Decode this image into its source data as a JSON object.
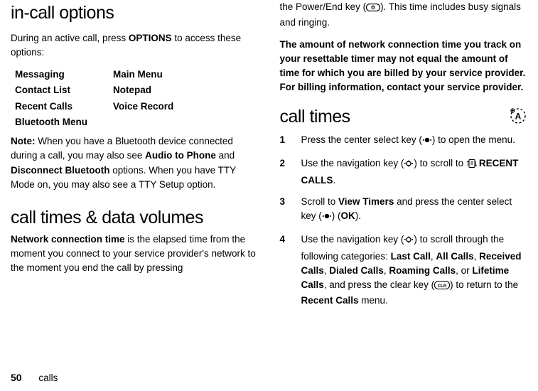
{
  "section1": {
    "title": "in-call options",
    "intro_pre": "During an active call, press ",
    "intro_key": "OPTIONS",
    "intro_post": " to access these options:",
    "table": [
      [
        "Messaging",
        "Main Menu"
      ],
      [
        "Contact List",
        "Notepad"
      ],
      [
        "Recent Calls",
        "Voice Record"
      ],
      [
        "Bluetooth Menu",
        ""
      ]
    ],
    "note_label": "Note:",
    "note_p1a": " When you have a Bluetooth device connected during a call, you may also see ",
    "note_audio": "Audio to Phone",
    "note_and": " and ",
    "note_disc": "Disconnect Bluetooth",
    "note_p1b": " options. When you have TTY Mode on, you may also see a TTY Setup option."
  },
  "section2": {
    "title": "call times & data volumes",
    "p1a": "Network connection time",
    "p1b": " is the elapsed time from the moment you connect to your service provider's network to the moment you end the call by pressing"
  },
  "col2": {
    "p1a": "the Power/End key (",
    "p1b": "). This time includes busy signals and ringing.",
    "p2": "The amount of network connection time you track on your resettable timer may not equal the amount of time for which you are billed by your service provider. For billing information, contact your service provider.",
    "calltimes_title": "call times",
    "steps": {
      "s1a": "Press the center select key (",
      "s1b": ") to open the menu.",
      "s2a": "Use the navigation key (",
      "s2b": ") to scroll to ",
      "s2c": "RECENT CALLS",
      "s2d": ".",
      "s3a": "Scroll to ",
      "s3b": "View Timers",
      "s3c": " and press the center select key (",
      "s3d": ") (",
      "s3e": "OK",
      "s3f": ").",
      "s4a": "Use the navigation key (",
      "s4b": ") to scroll through the following categories: ",
      "s4c1": "Last Call",
      "s4c2": "All Calls",
      "s4c3": "Received Calls",
      "s4c4": "Dialed Calls",
      "s4c5": "Roaming Calls",
      "s4c6": "Lifetime Calls",
      "s4d": ", and press the clear key (",
      "s4e": ") to return to the ",
      "s4f": "Recent Calls",
      "s4g": " menu."
    }
  },
  "footer": {
    "page": "50",
    "label": "calls"
  }
}
